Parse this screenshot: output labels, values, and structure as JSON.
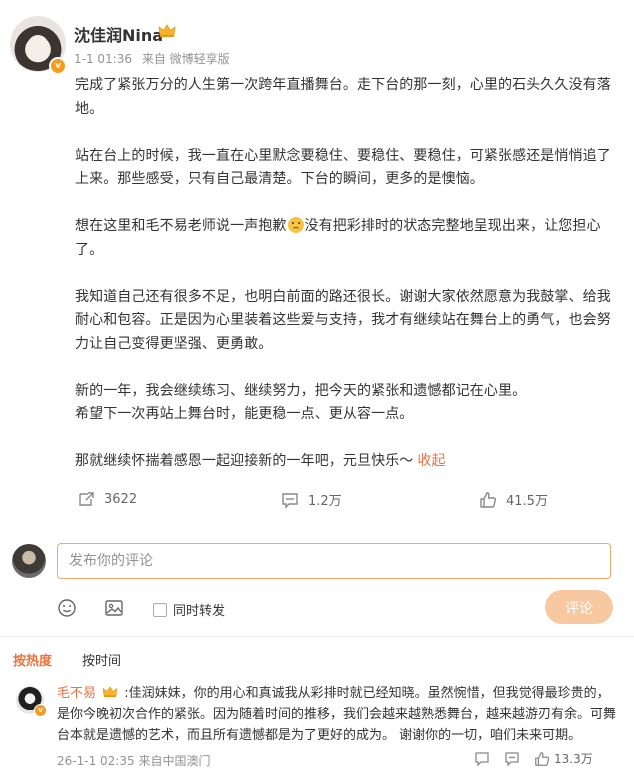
{
  "post": {
    "author": "沈佳润Nina",
    "time": "1-1 01:36",
    "source": "来自 微博轻享版",
    "paragraphs": [
      "完成了紧张万分的人生第一次跨年直播舞台。走下台的那一刻，心里的石头久久没有落地。",
      "站在台上的时候，我一直在心里默念要稳住、要稳住、要稳住，可紧张感还是悄悄追了上来。那些感受，只有自己最清楚。下台的瞬间，更多的是懊恼。",
      "想在这里和毛不易老师说一声抱歉",
      "没有把彩排时的状态完整地呈现出来，让您担心了。",
      "我知道自己还有很多不足，也明白前面的路还很长。谢谢大家依然愿意为我鼓掌、给我耐心和包容。正是因为心里装着这些爱与支持，我才有继续站在舞台上的勇气，也会努力让自己变得更坚强、更勇敢。",
      "新的一年，我会继续练习、继续努力，把今天的紧张和遗憾都记在心里。",
      "希望下一次再站上舞台时，能更稳一点、更从容一点。",
      "那就继续怀揣着感恩一起迎接新的一年吧，元旦快乐～"
    ],
    "collapse_label": "收起",
    "repost_count": "3622",
    "comment_count": "1.2万",
    "like_count": "41.5万"
  },
  "comment_form": {
    "placeholder": "发布你的评论",
    "repost_label": "同时转发",
    "submit_label": "评论"
  },
  "sort_tabs": [
    "按热度",
    "按时间"
  ],
  "comments": [
    {
      "author": "毛不易",
      "text": ":佳润妹妹，你的用心和真诚我从彩排时就已经知晓。虽然惋惜，但我觉得最珍贵的，是你今晚初次合作的紧张。因为随着时间的推移，我们会越来越熟悉舞台，越来越游刃有余。可舞台本就是遗憾的艺术，而且所有遗憾都是为了更好的成为。 谢谢你的一切，咱们未来可期。",
      "time": "26-1-1 02:35",
      "source": "来自中国澳门",
      "like_count": "13.3万"
    }
  ],
  "colors": {
    "accent": "#eb7340",
    "meta": "#939393",
    "badge": "#f59b1e"
  },
  "icons": [
    "repost-icon",
    "comment-icon",
    "like-icon",
    "emoji-icon",
    "image-icon",
    "crown-icon",
    "more-icon"
  ]
}
